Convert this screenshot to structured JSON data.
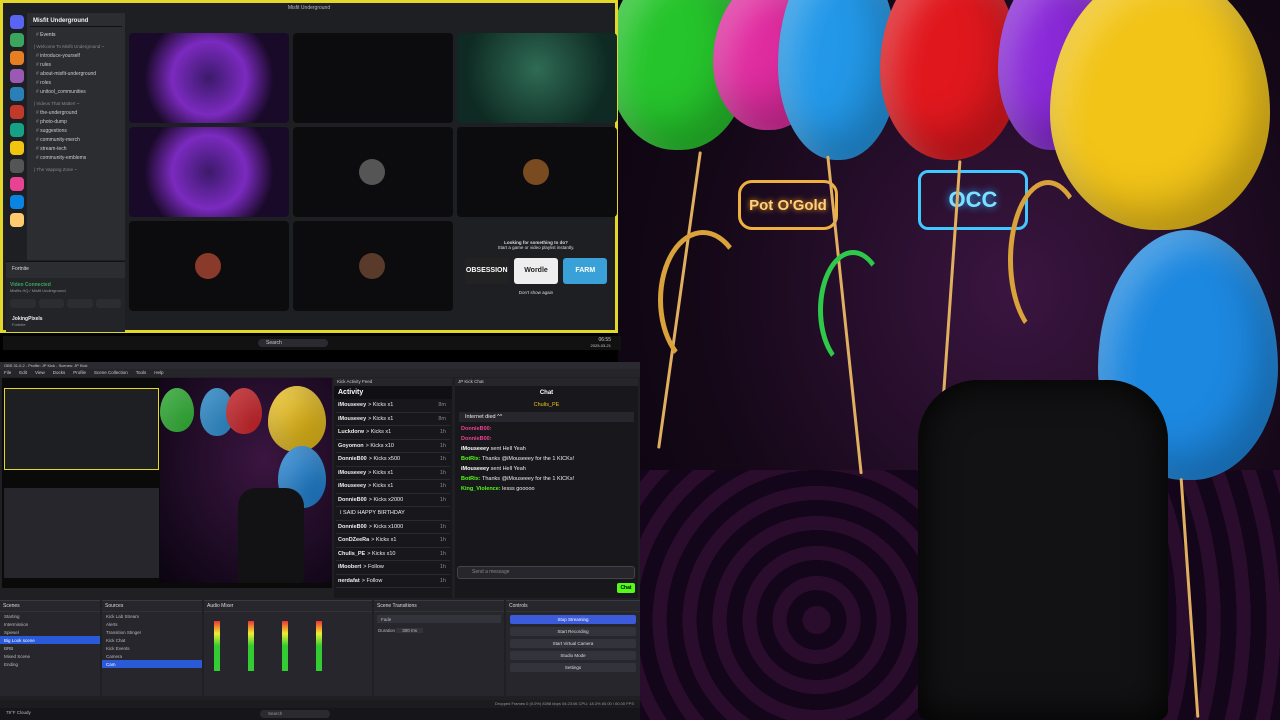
{
  "discord": {
    "title": "Misfit Underground",
    "server": "Misfit Underground",
    "events_label": "Events",
    "category1": "| Welcome To Misfit Underground ~",
    "channels1": [
      "introduce-yourself",
      "rules",
      "about-misfit-underground",
      "roles",
      "unitool_communities"
    ],
    "category2": "| Videos That Matter! ~",
    "channels2": [
      "the-underground",
      "photo-dump",
      "suggestions",
      "community-merch",
      "stream-tech",
      "community-emblems"
    ],
    "category3": "| The Vapping Zone ~",
    "activity_game": "Fortnite",
    "voice_status": "Video Connected",
    "voice_sub": "Misfits HQ / Misfit Underground",
    "user_name": "JokingPixels",
    "user_status": "Fortnite",
    "invite_title": "Looking for something to do?",
    "invite_sub": "Start a game or video playlist instantly.",
    "games": [
      "OBSESSION",
      "Wordle",
      "FARM"
    ],
    "dont_show": "Don't show again",
    "taskbar_search": "Search",
    "tray_time": "06:55",
    "tray_date": "2025-03-21"
  },
  "obs": {
    "title": "OBS 31.0.2 - Profile: JP Kick - Scenes: JP Kick",
    "menu": [
      "File",
      "Edit",
      "View",
      "Docks",
      "Profile",
      "Scene Collection",
      "Tools",
      "Help"
    ],
    "activity_header": "Kick Activity Feed",
    "activity_title": "Activity",
    "activity": [
      {
        "name": "iMouseeey",
        "text": "> Kicks x1",
        "time": "8m"
      },
      {
        "name": "iMouseeey",
        "text": "> Kicks x1",
        "time": "8m"
      },
      {
        "name": "Luckdorw",
        "text": "> Kicks x1",
        "time": "1h"
      },
      {
        "name": "Goyomon",
        "text": "> Kicks x10",
        "time": "1h"
      },
      {
        "name": "DonnieB00",
        "text": "> Kicks x500",
        "time": "1h"
      },
      {
        "name": "iMouseeey",
        "text": "> Kicks x1",
        "time": "1h"
      },
      {
        "name": "iMouseeey",
        "text": "> Kicks x1",
        "time": "1h"
      },
      {
        "name": "DonnieB00",
        "text": "> Kicks x2000",
        "time": "1h"
      },
      {
        "name": "",
        "text": "I SAID HAPPY BIRTHDAY",
        "time": ""
      },
      {
        "name": "DonnieB00",
        "text": "> Kicks x1000",
        "time": "1h"
      },
      {
        "name": "ConDZeeRa",
        "text": "> Kicks x1",
        "time": "1h"
      },
      {
        "name": "Chulis_PE",
        "text": "> Kicks x10",
        "time": "1h"
      },
      {
        "name": "iMoobert",
        "text": "> Follow",
        "time": "1h"
      },
      {
        "name": "nerdafat",
        "text": "> Follow",
        "time": "1h"
      }
    ],
    "chat_header": "JP Kick Chat",
    "chat_title": "Chat",
    "chat_pinned_user": "Chulis_PE",
    "chat_pinned_note": "Internet died ^^",
    "chat_msgs": [
      {
        "user": "DonnieB00:",
        "text": ""
      },
      {
        "user": "DonnieB00:",
        "text": ""
      },
      {
        "user": "iMouseeey",
        "text": "sent Hell Yeah"
      },
      {
        "user": "BotRix:",
        "text": "Thanks @iMouseeey for the 1 KICKs!"
      },
      {
        "user": "iMouseeey",
        "text": "sent Hell Yeah"
      },
      {
        "user": "BotRix:",
        "text": "Thanks @iMouseeey for the 1 KICKs!"
      },
      {
        "user": "King_Violence:",
        "text": "lesss gooooo"
      }
    ],
    "chat_placeholder": "Send a message",
    "chat_button": "Chat",
    "docks": [
      "Scenes",
      "Sources",
      "Audio Mixer",
      "Scene Transitions",
      "Controls"
    ],
    "scenes": [
      "Starting",
      "Intermission",
      "Spiesel",
      "Big Look scene",
      "BRB",
      "Mixed Scene",
      "Ending"
    ],
    "sources": [
      "Kick Lab Stream",
      "Alerts",
      "Transition Stinger",
      "Kick Chat",
      "Kick Events",
      "Camera",
      "Cam"
    ],
    "transition": "Fade",
    "duration_label": "Duration",
    "duration": "300 ms",
    "controls": [
      "Stop Streaming",
      "Start Recording",
      "Start Virtual Camera",
      "Studio Mode",
      "Settings"
    ],
    "status": "Dropped Frames 0 (0.0%)   8398 kbps   04:23:06   CPU: 18.3%   60.00 / 60.00 FPS",
    "win_search": "Search",
    "weather": "79°F Cloudy"
  },
  "party": {
    "neon1": "Pot O'Gold",
    "neon2": "OCC"
  }
}
